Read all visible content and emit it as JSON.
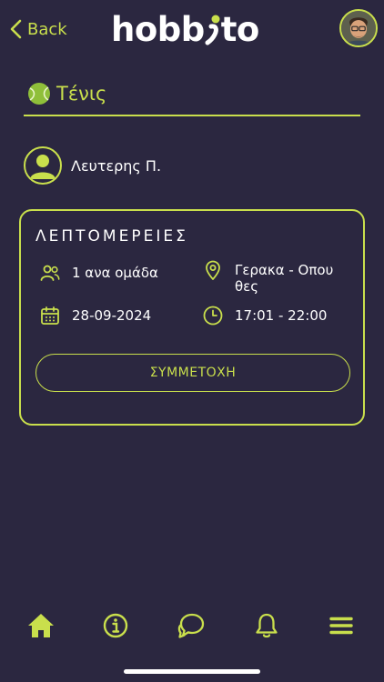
{
  "header": {
    "back_label": "Back",
    "logo_text_left": "hobb",
    "logo_text_right": "to"
  },
  "sport": {
    "title": "Τένις",
    "icon": "tennis-ball-icon"
  },
  "organizer": {
    "name": "Λευτερης Π.",
    "icon": "user-silhouette-icon"
  },
  "details": {
    "title": "ΛΕΠΤΟΜΕΡΕΙΕΣ",
    "group_text": "1 ανα ομάδα",
    "location_line1": "Γερακα - Οπου",
    "location_line2": "θες",
    "date": "28-09-2024",
    "time": "17:01 - 22:00",
    "join_label": "ΣΥΜΜΕΤΟΧΗ"
  },
  "nav": {
    "items": [
      "home-icon",
      "info-icon",
      "chat-icon",
      "bell-icon",
      "menu-icon"
    ]
  },
  "colors": {
    "accent": "#c9df4c",
    "background": "#2b2740"
  }
}
